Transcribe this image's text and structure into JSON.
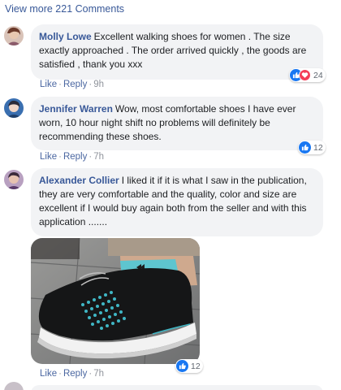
{
  "view_more": "View more 221 Comments",
  "colors": {
    "link": "#385898",
    "bubble": "#f2f3f5",
    "like": "#1877f2",
    "love": "#f33e58"
  },
  "comments": [
    {
      "author": "Molly Lowe",
      "text": "Excellent walking shoes for women . The size exactly approached . The order arrived quickly , the goods are satisfied , thank you xxx",
      "like_label": "Like",
      "reply_label": "Reply",
      "time": "9h",
      "reaction_icons": [
        "like-icon",
        "love-icon"
      ],
      "reaction_count": "24"
    },
    {
      "author": "Jennifer Warren",
      "text": "Wow, most comfortable shoes I have ever worn, 10 hour night shift no problems will definitely be recommending these shoes.",
      "like_label": "Like",
      "reply_label": "Reply",
      "time": "7h",
      "reaction_icons": [
        "like-icon"
      ],
      "reaction_count": "12"
    },
    {
      "author": "Alexander Collier",
      "text": "I liked it if it is what I saw in the publication, they are very comfortable and the quality, color and size are excellent if I would buy again both from the seller and with this application .......",
      "like_label": "Like",
      "reply_label": "Reply",
      "time": "7h",
      "reaction_icons": [
        "like-icon"
      ],
      "reaction_count": "12",
      "attachment_icon": "shoe-photo"
    }
  ]
}
